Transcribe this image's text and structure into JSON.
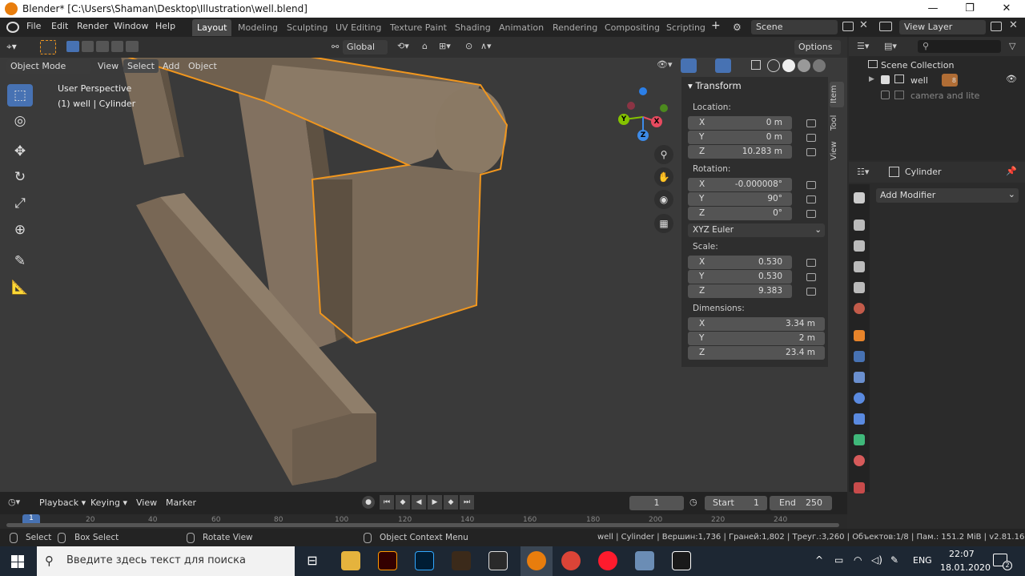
{
  "window": {
    "title": "Blender* [C:\\Users\\Shaman\\Desktop\\Illustration\\well.blend]",
    "minimize": "—",
    "restore": "❐",
    "close": "✕"
  },
  "menu": {
    "items": [
      "File",
      "Edit",
      "Render",
      "Window",
      "Help"
    ]
  },
  "workspaces": [
    "Layout",
    "Modeling",
    "Sculpting",
    "UV Editing",
    "Texture Paint",
    "Shading",
    "Animation",
    "Rendering",
    "Compositing",
    "Scripting"
  ],
  "workspace_add": "+",
  "scene": {
    "label": "Scene",
    "viewlayer": "View Layer"
  },
  "viewport_header": {
    "orientation": "Global",
    "options": "Options"
  },
  "viewport_header2": {
    "mode": "Object Mode",
    "items": [
      "View",
      "Select",
      "Add",
      "Object"
    ]
  },
  "viewport": {
    "perspective": "User Perspective",
    "object_info": "(1) well | Cylinder",
    "gizmo_axes": [
      "X",
      "Y",
      "Z"
    ]
  },
  "npanel": {
    "header": "Transform",
    "location_label": "Location:",
    "location": [
      {
        "k": "X",
        "v": "0 m"
      },
      {
        "k": "Y",
        "v": "0 m"
      },
      {
        "k": "Z",
        "v": "10.283 m"
      }
    ],
    "rotation_label": "Rotation:",
    "rotation": [
      {
        "k": "X",
        "v": "-0.000008°"
      },
      {
        "k": "Y",
        "v": "90°"
      },
      {
        "k": "Z",
        "v": "0°"
      }
    ],
    "rotation_mode": "XYZ Euler",
    "scale_label": "Scale:",
    "scale": [
      {
        "k": "X",
        "v": "0.530"
      },
      {
        "k": "Y",
        "v": "0.530"
      },
      {
        "k": "Z",
        "v": "9.383"
      }
    ],
    "dimensions_label": "Dimensions:",
    "dimensions": [
      {
        "k": "X",
        "v": "3.34 m"
      },
      {
        "k": "Y",
        "v": "2 m"
      },
      {
        "k": "Z",
        "v": "23.4 m"
      }
    ],
    "tabs": [
      "Item",
      "Tool",
      "View"
    ]
  },
  "outliner": {
    "collection": "Scene Collection",
    "items": [
      {
        "name": "well",
        "badge": "8"
      },
      {
        "name": "camera and lite"
      }
    ]
  },
  "properties": {
    "object": "Cylinder",
    "add_modifier": "Add Modifier"
  },
  "timeline": {
    "items": [
      "Playback",
      "Keying",
      "View",
      "Marker"
    ],
    "current_frame": "1",
    "start_label": "Start",
    "start": "1",
    "end_label": "End",
    "end": "250",
    "ruler": [
      "1",
      "20",
      "40",
      "60",
      "80",
      "100",
      "120",
      "140",
      "160",
      "180",
      "200",
      "220",
      "240"
    ]
  },
  "statusbar": {
    "select": "Select",
    "box_select": "Box Select",
    "rotate_view": "Rotate View",
    "context_menu": "Object Context Menu",
    "stats": "well | Cylinder | Вершин:1,736 | Граней:1,802 | Треуг.:3,260 | Объектов:1/8 | Пам.: 151.2 MiB | v2.81.16"
  },
  "taskbar": {
    "search_placeholder": "Введите здесь текст для поиска",
    "lang": "ENG",
    "time": "22:07",
    "date": "18.01.2020",
    "notifications": "2"
  },
  "colors": {
    "accent": "#4772b3",
    "selection": "#f0961e",
    "object": "#7d6c5a",
    "blender_orange": "#e87d0d"
  }
}
